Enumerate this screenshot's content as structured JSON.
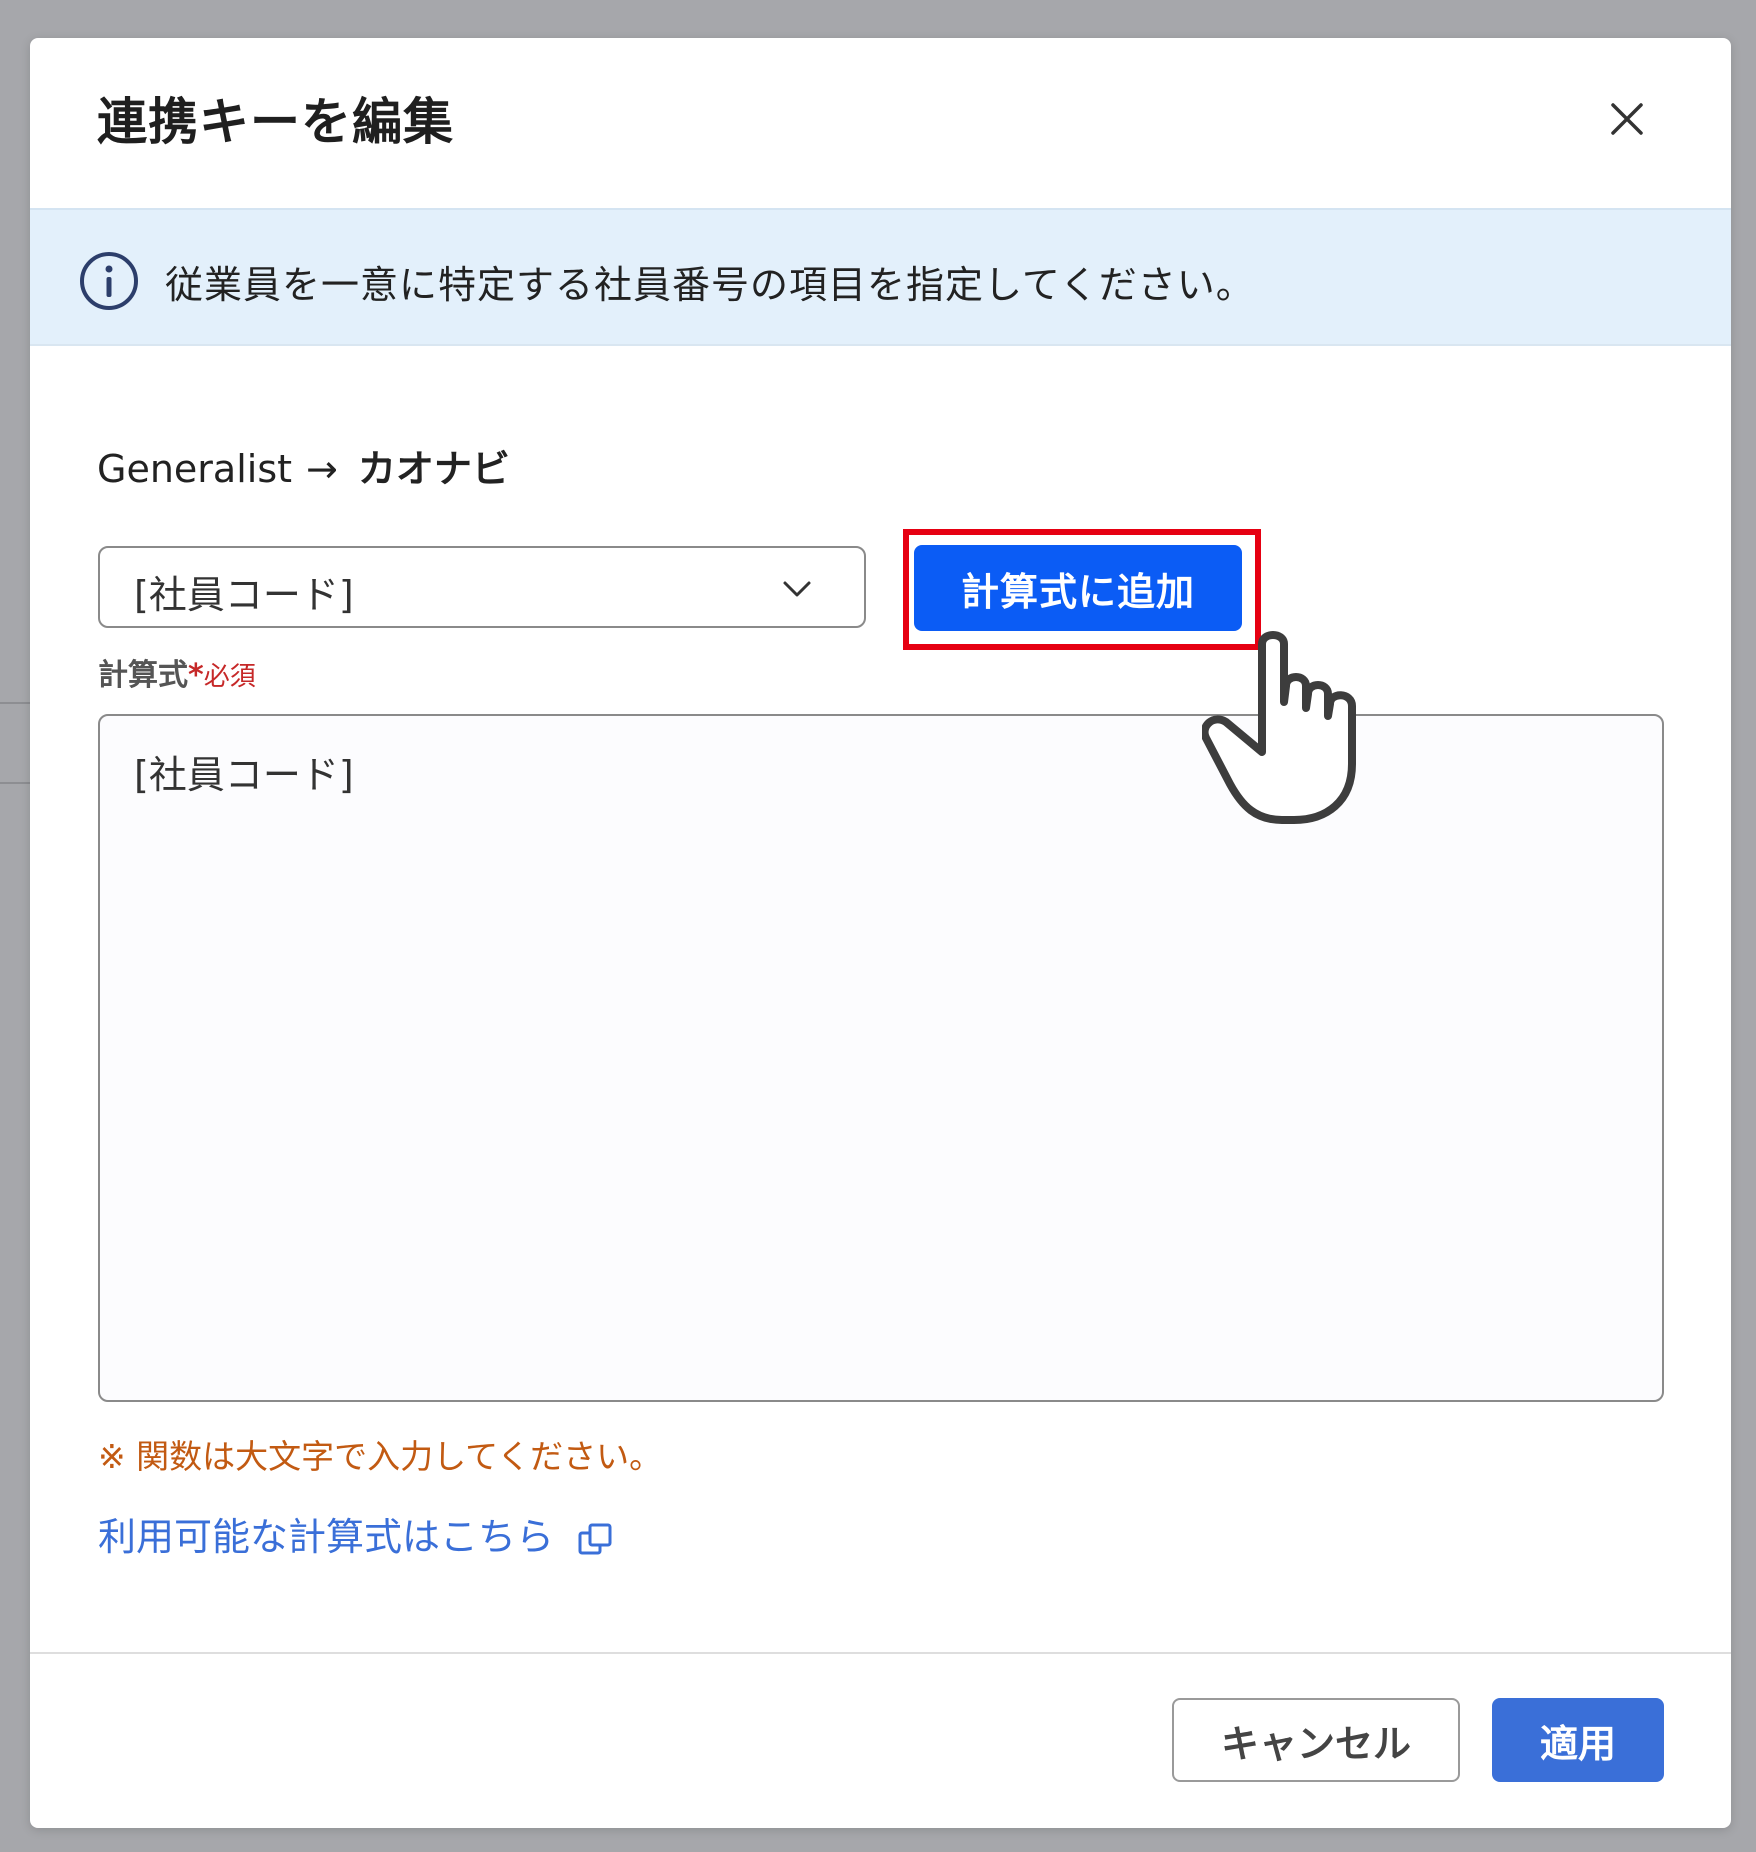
{
  "dialog": {
    "title": "連携キーを編集",
    "close_icon": "close-icon"
  },
  "info_banner": {
    "icon": "info-icon",
    "text": "従業員を一意に特定する社員番号の項目を指定してください。"
  },
  "mapping": {
    "source": "Generalist",
    "arrow": "→",
    "target": "カオナビ"
  },
  "field_select": {
    "value": "[社員コード]",
    "icon": "chevron-down-icon"
  },
  "add_button": {
    "label": "計算式に追加"
  },
  "formula": {
    "label": "計算式",
    "required_mark": "*",
    "required_text": "必須",
    "value": "[社員コード]"
  },
  "note": "※ 関数は大文字で入力してください。",
  "formula_link": {
    "label": "利用可能な計算式はこちら",
    "icon": "external-link-icon"
  },
  "footer": {
    "cancel_label": "キャンセル",
    "apply_label": "適用"
  },
  "colors": {
    "primary_button": "#0b5cf5",
    "apply_button": "#3a6fd8",
    "highlight_border": "#e60012",
    "info_background": "#e3f0fb",
    "note_text": "#c25a12",
    "required_text": "#c62828"
  }
}
